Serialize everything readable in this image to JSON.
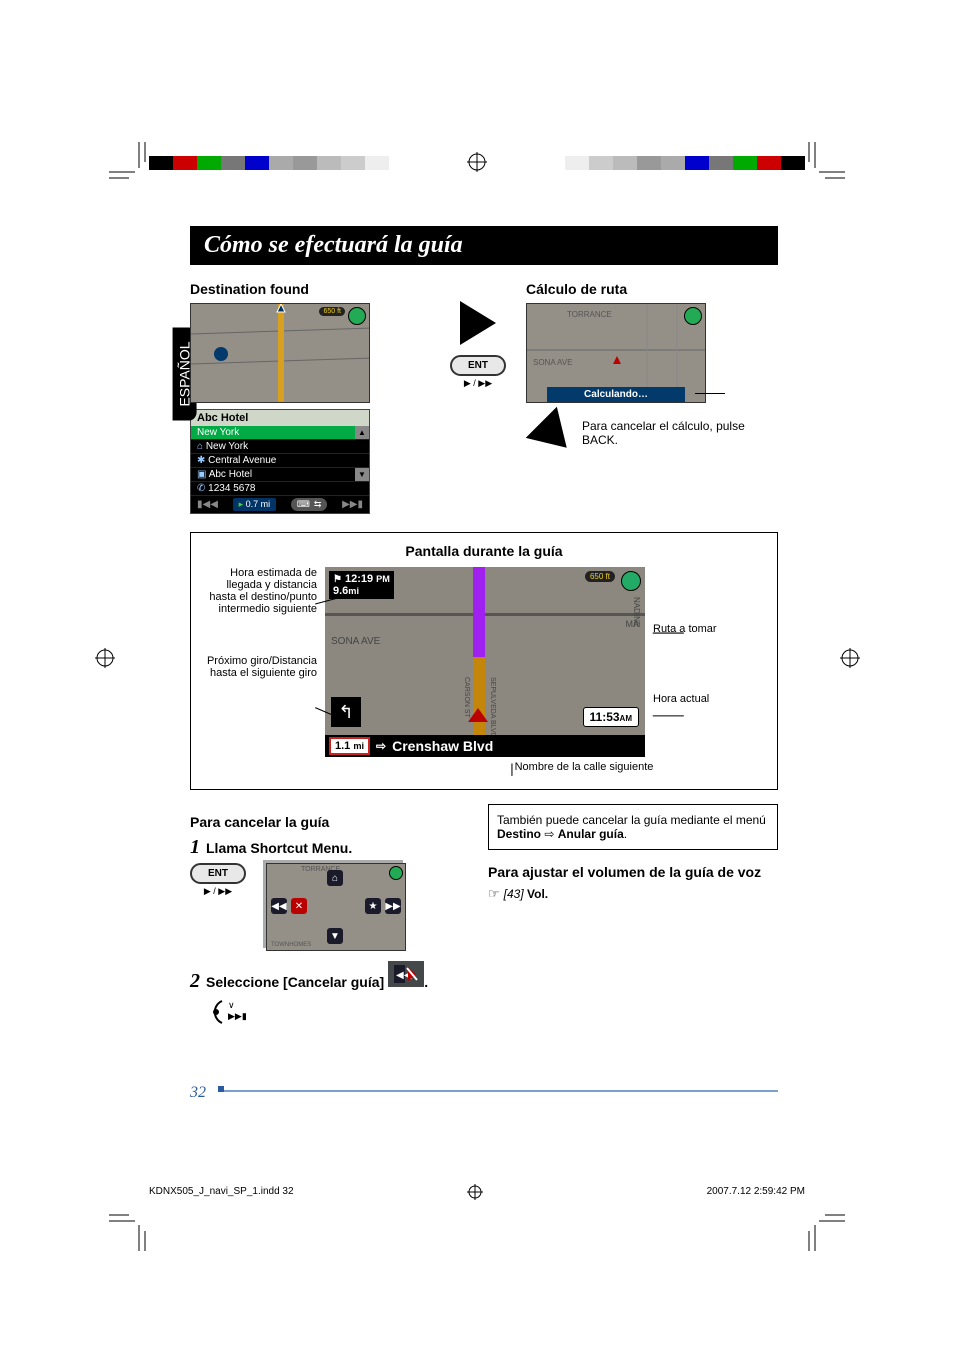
{
  "lang_tab": "ESPAÑOL",
  "title": "Cómo se efectuará la guía",
  "section_destination": "Destination found",
  "section_calculo": "Cálculo de ruta",
  "calc_bar_text": "Calculando…",
  "calc_cancel_text": "Para cancelar el cálculo, pulse BACK.",
  "map_labels": {
    "scale_650": "650 ft",
    "torrance": "TORRANCE",
    "sona_ave": "SONA  AVE",
    "nadine": "NADINE",
    "sepulveda": "SEPULVEDA BLVD",
    "carson": "CARSON ST",
    "ma": "MA"
  },
  "dest_list": {
    "title": "Abc Hotel",
    "items": [
      "New York",
      "New York",
      "Central Avenue",
      "Abc Hotel",
      "1234 5678"
    ],
    "distance": "0.7 mi"
  },
  "ent_label": "ENT",
  "ent_sub_glyphs": "▶ / ▶▶",
  "guidance": {
    "box_title": "Pantalla durante la guía",
    "eta_time": "12:19",
    "eta_suffix": "PM",
    "eta_dist": "9.6",
    "eta_dist_unit": "mi",
    "clock": "11:53",
    "clock_suffix": "AM",
    "turn_dist": "1.1",
    "turn_dist_unit": "mi",
    "next_street": "Crenshaw Blvd",
    "label_eta": "Hora estimada de llegada y distancia hasta el destino/punto intermedio siguiente",
    "label_turn": "Próximo giro/Distancia hasta el siguiente giro",
    "label_route": "Ruta a tomar",
    "label_clock": "Hora actual",
    "label_street": "Nombre de la calle siguiente"
  },
  "cancel": {
    "heading": "Para cancelar la guía",
    "step1": "Llama Shortcut Menu.",
    "step2_pre": "Seleccione [Cancelar guía]",
    "step2_post": "."
  },
  "info_box": {
    "text_pre": "También puede cancelar la guía mediante el menú ",
    "menu1": "Destino",
    "arrow": "⇨",
    "menu2": "Anular guía",
    "tail": "."
  },
  "volume": {
    "heading": "Para ajustar el volumen de la guía de voz",
    "ref": "☞",
    "ref_num": "[43]",
    "ref_label": "Vol."
  },
  "page_number": "32",
  "footer_left": "KDNX505_J_navi_SP_1.indd   32",
  "footer_right": "2007.7.12   2:59:42 PM"
}
